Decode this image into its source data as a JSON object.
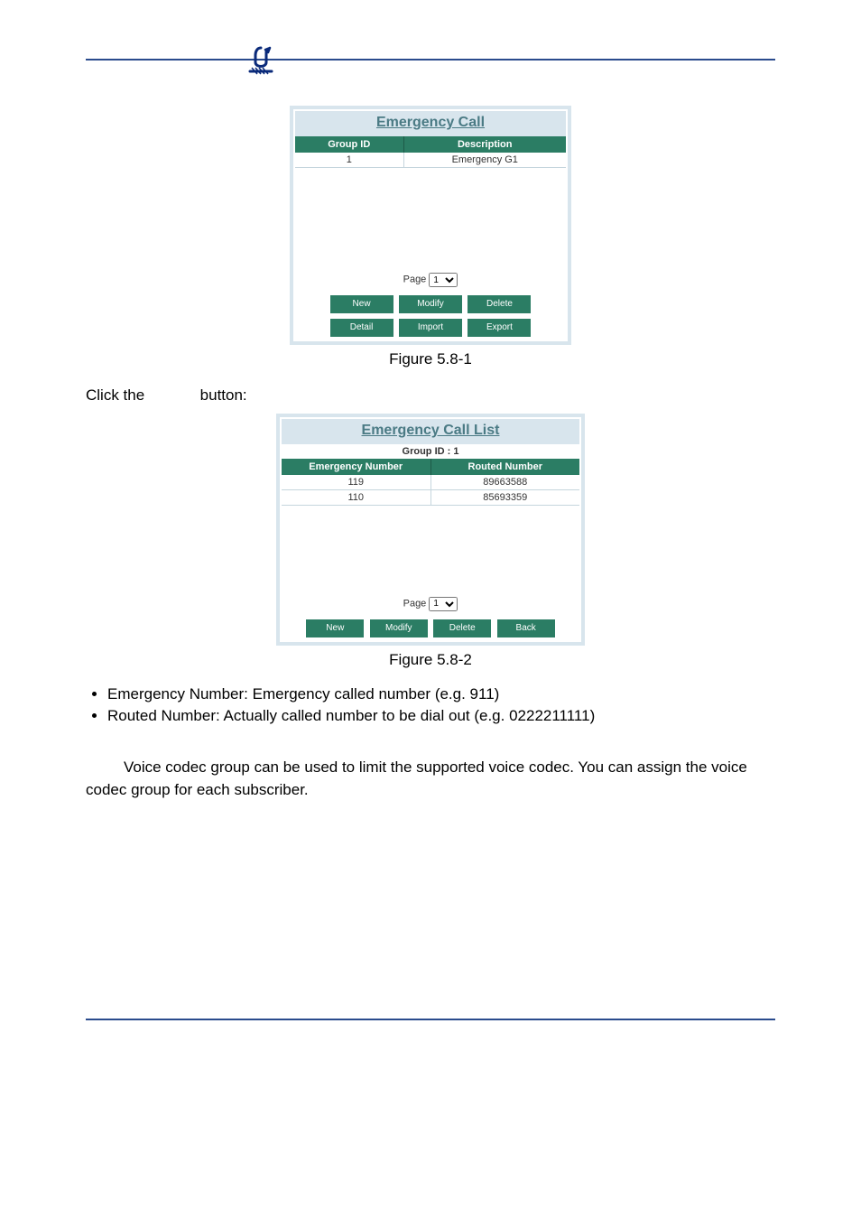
{
  "panel1": {
    "title": "Emergency Call",
    "headers": {
      "group_id": "Group ID",
      "description": "Description"
    },
    "rows": [
      {
        "group_id": "1",
        "description": "Emergency G1"
      }
    ],
    "page_label": "Page",
    "page_value": "1",
    "buttons": {
      "new": "New",
      "modify": "Modify",
      "delete": "Delete",
      "detail": "Detail",
      "import": "Import",
      "export": "Export"
    }
  },
  "caption1": "Figure 5.8-1",
  "click_text": {
    "pre": "Click the",
    "post": "button:"
  },
  "panel2": {
    "title": "Emergency Call List",
    "group_label": "Group ID : 1",
    "headers": {
      "emergency_number": "Emergency Number",
      "routed_number": "Routed Number"
    },
    "rows": [
      {
        "emergency_number": "119",
        "routed_number": "89663588"
      },
      {
        "emergency_number": "110",
        "routed_number": "85693359"
      }
    ],
    "page_label": "Page",
    "page_value": "1",
    "buttons": {
      "new": "New",
      "modify": "Modify",
      "delete": "Delete",
      "back": "Back"
    }
  },
  "caption2": "Figure 5.8-2",
  "bullets": {
    "b1": "Emergency Number: Emergency called number (e.g. 911)",
    "b2": "Routed Number: Actually called number to be dial out (e.g. 0222211111)"
  },
  "para": "Voice codec group can be used to limit the supported voice codec. You can assign the voice codec group for each subscriber."
}
